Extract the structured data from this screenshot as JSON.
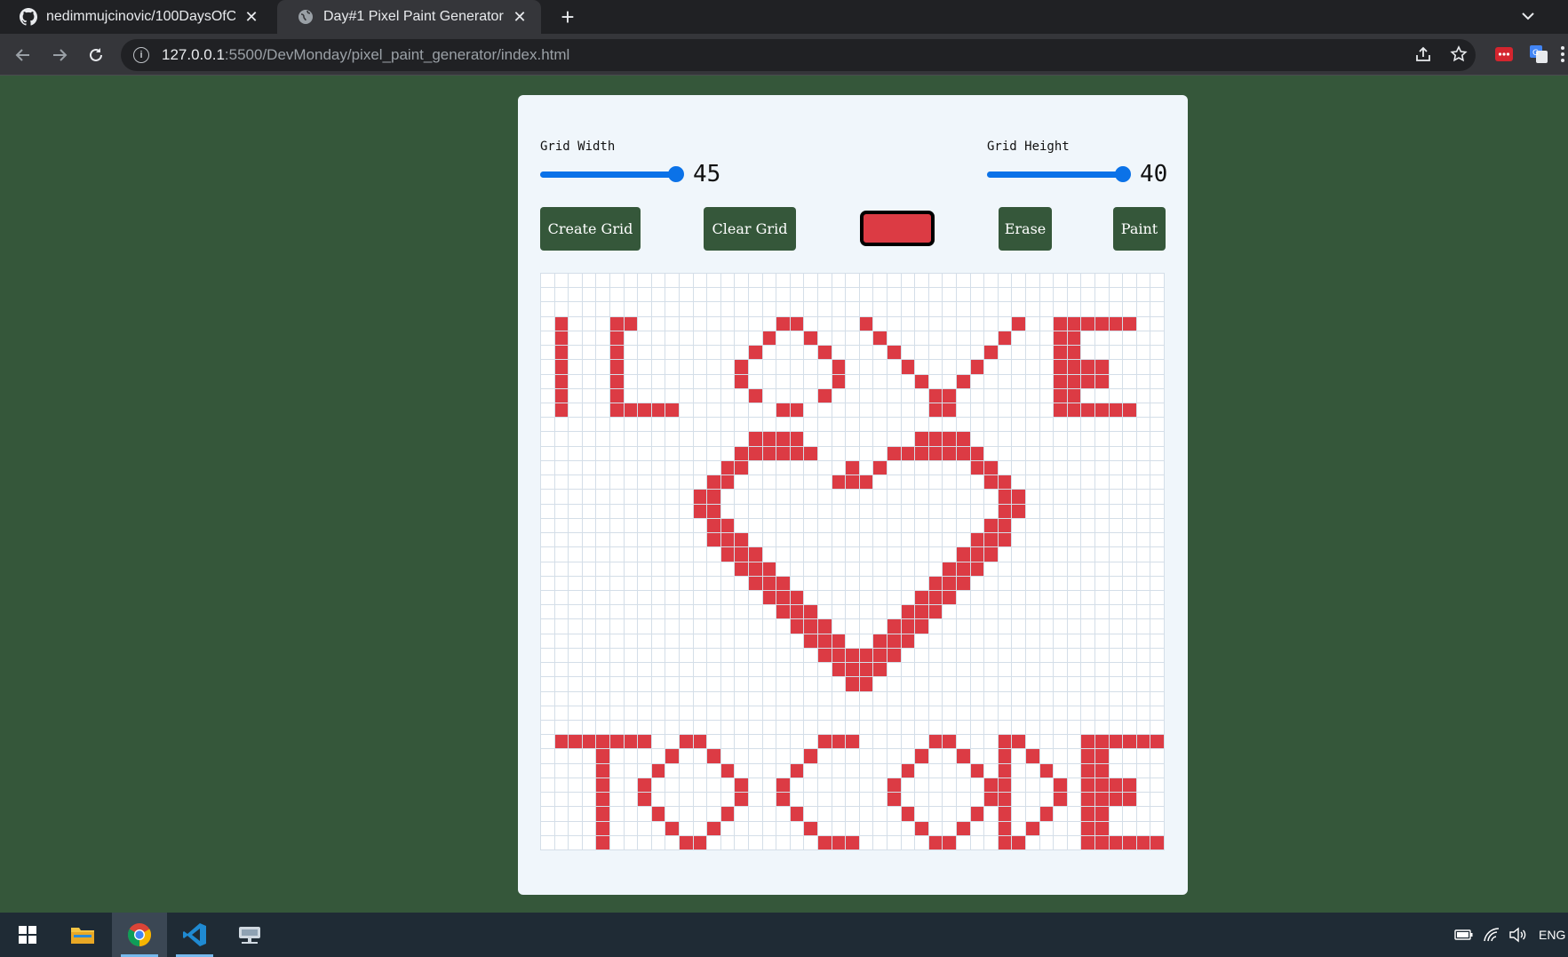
{
  "browser": {
    "tabs": [
      {
        "title": "nedimmujcinovic/100DaysOfCode",
        "icon": "github-icon",
        "active": false
      },
      {
        "title": "Day#1 Pixel Paint Generator",
        "icon": "globe-icon",
        "active": true
      }
    ],
    "new_tab": "+",
    "url_host": "127.0.0.1",
    "url_rest": ":5500/DevMonday/pixel_paint_generator/index.html"
  },
  "controls": {
    "width_label": "Grid Width",
    "width_value": "45",
    "width_range": [
      1,
      45
    ],
    "height_label": "Grid Height",
    "height_value": "40",
    "height_range": [
      1,
      40
    ],
    "create_label": "Create Grid",
    "clear_label": "Clear Grid",
    "erase_label": "Erase",
    "paint_label": "Paint",
    "paint_color": "#dc3b44"
  },
  "grid": {
    "cols": 45,
    "rows": 40,
    "cell_color": "#ffffff",
    "painted_color": "#dc3b44",
    "painted": [
      [
        3,
        1
      ],
      [
        3,
        5
      ],
      [
        3,
        6
      ],
      [
        3,
        17
      ],
      [
        3,
        18
      ],
      [
        3,
        23
      ],
      [
        3,
        34
      ],
      [
        3,
        37
      ],
      [
        3,
        38
      ],
      [
        3,
        39
      ],
      [
        3,
        40
      ],
      [
        3,
        41
      ],
      [
        3,
        42
      ],
      [
        4,
        1
      ],
      [
        4,
        5
      ],
      [
        4,
        16
      ],
      [
        4,
        19
      ],
      [
        4,
        24
      ],
      [
        4,
        33
      ],
      [
        4,
        37
      ],
      [
        4,
        38
      ],
      [
        5,
        1
      ],
      [
        5,
        5
      ],
      [
        5,
        15
      ],
      [
        5,
        20
      ],
      [
        5,
        25
      ],
      [
        5,
        32
      ],
      [
        5,
        37
      ],
      [
        5,
        38
      ],
      [
        6,
        1
      ],
      [
        6,
        5
      ],
      [
        6,
        14
      ],
      [
        6,
        21
      ],
      [
        6,
        26
      ],
      [
        6,
        31
      ],
      [
        6,
        37
      ],
      [
        6,
        38
      ],
      [
        6,
        39
      ],
      [
        6,
        40
      ],
      [
        7,
        1
      ],
      [
        7,
        5
      ],
      [
        7,
        14
      ],
      [
        7,
        21
      ],
      [
        7,
        27
      ],
      [
        7,
        30
      ],
      [
        7,
        37
      ],
      [
        7,
        38
      ],
      [
        7,
        39
      ],
      [
        7,
        40
      ],
      [
        8,
        1
      ],
      [
        8,
        5
      ],
      [
        8,
        15
      ],
      [
        8,
        20
      ],
      [
        8,
        28
      ],
      [
        8,
        29
      ],
      [
        8,
        37
      ],
      [
        8,
        38
      ],
      [
        9,
        1
      ],
      [
        9,
        5
      ],
      [
        9,
        6
      ],
      [
        9,
        7
      ],
      [
        9,
        8
      ],
      [
        9,
        9
      ],
      [
        9,
        17
      ],
      [
        9,
        18
      ],
      [
        9,
        28
      ],
      [
        9,
        29
      ],
      [
        9,
        37
      ],
      [
        9,
        38
      ],
      [
        9,
        39
      ],
      [
        9,
        40
      ],
      [
        9,
        41
      ],
      [
        9,
        42
      ],
      [
        11,
        15
      ],
      [
        11,
        16
      ],
      [
        11,
        17
      ],
      [
        11,
        18
      ],
      [
        11,
        27
      ],
      [
        11,
        28
      ],
      [
        11,
        29
      ],
      [
        11,
        30
      ],
      [
        12,
        14
      ],
      [
        12,
        15
      ],
      [
        12,
        16
      ],
      [
        12,
        17
      ],
      [
        12,
        18
      ],
      [
        12,
        19
      ],
      [
        12,
        25
      ],
      [
        12,
        26
      ],
      [
        12,
        27
      ],
      [
        12,
        28
      ],
      [
        12,
        29
      ],
      [
        12,
        30
      ],
      [
        12,
        31
      ],
      [
        13,
        13
      ],
      [
        13,
        14
      ],
      [
        13,
        22
      ],
      [
        13,
        24
      ],
      [
        13,
        31
      ],
      [
        13,
        32
      ],
      [
        14,
        12
      ],
      [
        14,
        13
      ],
      [
        14,
        21
      ],
      [
        14,
        22
      ],
      [
        14,
        23
      ],
      [
        14,
        32
      ],
      [
        14,
        33
      ],
      [
        15,
        11
      ],
      [
        15,
        12
      ],
      [
        15,
        33
      ],
      [
        15,
        34
      ],
      [
        16,
        11
      ],
      [
        16,
        12
      ],
      [
        16,
        33
      ],
      [
        16,
        34
      ],
      [
        17,
        12
      ],
      [
        17,
        13
      ],
      [
        17,
        32
      ],
      [
        17,
        33
      ],
      [
        18,
        12
      ],
      [
        18,
        13
      ],
      [
        18,
        14
      ],
      [
        18,
        31
      ],
      [
        18,
        32
      ],
      [
        18,
        33
      ],
      [
        19,
        13
      ],
      [
        19,
        14
      ],
      [
        19,
        15
      ],
      [
        19,
        30
      ],
      [
        19,
        31
      ],
      [
        19,
        32
      ],
      [
        20,
        14
      ],
      [
        20,
        15
      ],
      [
        20,
        16
      ],
      [
        20,
        29
      ],
      [
        20,
        30
      ],
      [
        20,
        31
      ],
      [
        21,
        15
      ],
      [
        21,
        16
      ],
      [
        21,
        17
      ],
      [
        21,
        28
      ],
      [
        21,
        29
      ],
      [
        21,
        30
      ],
      [
        22,
        16
      ],
      [
        22,
        17
      ],
      [
        22,
        18
      ],
      [
        22,
        27
      ],
      [
        22,
        28
      ],
      [
        22,
        29
      ],
      [
        23,
        17
      ],
      [
        23,
        18
      ],
      [
        23,
        19
      ],
      [
        23,
        26
      ],
      [
        23,
        27
      ],
      [
        23,
        28
      ],
      [
        24,
        18
      ],
      [
        24,
        19
      ],
      [
        24,
        20
      ],
      [
        24,
        25
      ],
      [
        24,
        26
      ],
      [
        24,
        27
      ],
      [
        25,
        19
      ],
      [
        25,
        20
      ],
      [
        25,
        21
      ],
      [
        25,
        24
      ],
      [
        25,
        25
      ],
      [
        25,
        26
      ],
      [
        26,
        20
      ],
      [
        26,
        21
      ],
      [
        26,
        22
      ],
      [
        26,
        23
      ],
      [
        26,
        24
      ],
      [
        26,
        25
      ],
      [
        27,
        21
      ],
      [
        27,
        22
      ],
      [
        27,
        23
      ],
      [
        27,
        24
      ],
      [
        28,
        22
      ],
      [
        28,
        23
      ],
      [
        32,
        1
      ],
      [
        32,
        2
      ],
      [
        32,
        3
      ],
      [
        32,
        4
      ],
      [
        32,
        5
      ],
      [
        32,
        6
      ],
      [
        32,
        7
      ],
      [
        32,
        10
      ],
      [
        32,
        11
      ],
      [
        32,
        20
      ],
      [
        32,
        21
      ],
      [
        32,
        22
      ],
      [
        32,
        28
      ],
      [
        32,
        29
      ],
      [
        32,
        33
      ],
      [
        32,
        34
      ],
      [
        32,
        39
      ],
      [
        32,
        40
      ],
      [
        32,
        41
      ],
      [
        32,
        42
      ],
      [
        32,
        43
      ],
      [
        32,
        44
      ],
      [
        33,
        4
      ],
      [
        33,
        9
      ],
      [
        33,
        12
      ],
      [
        33,
        19
      ],
      [
        33,
        27
      ],
      [
        33,
        30
      ],
      [
        33,
        33
      ],
      [
        33,
        35
      ],
      [
        33,
        39
      ],
      [
        33,
        40
      ],
      [
        34,
        4
      ],
      [
        34,
        8
      ],
      [
        34,
        13
      ],
      [
        34,
        18
      ],
      [
        34,
        26
      ],
      [
        34,
        31
      ],
      [
        34,
        33
      ],
      [
        34,
        36
      ],
      [
        34,
        39
      ],
      [
        34,
        40
      ],
      [
        35,
        4
      ],
      [
        35,
        7
      ],
      [
        35,
        14
      ],
      [
        35,
        17
      ],
      [
        35,
        25
      ],
      [
        35,
        32
      ],
      [
        35,
        33
      ],
      [
        35,
        37
      ],
      [
        35,
        39
      ],
      [
        35,
        40
      ],
      [
        35,
        41
      ],
      [
        35,
        42
      ],
      [
        36,
        4
      ],
      [
        36,
        7
      ],
      [
        36,
        14
      ],
      [
        36,
        17
      ],
      [
        36,
        25
      ],
      [
        36,
        32
      ],
      [
        36,
        33
      ],
      [
        36,
        37
      ],
      [
        36,
        39
      ],
      [
        36,
        40
      ],
      [
        36,
        41
      ],
      [
        36,
        42
      ],
      [
        37,
        4
      ],
      [
        37,
        8
      ],
      [
        37,
        13
      ],
      [
        37,
        18
      ],
      [
        37,
        26
      ],
      [
        37,
        31
      ],
      [
        37,
        33
      ],
      [
        37,
        36
      ],
      [
        37,
        39
      ],
      [
        37,
        40
      ],
      [
        38,
        4
      ],
      [
        38,
        9
      ],
      [
        38,
        12
      ],
      [
        38,
        19
      ],
      [
        38,
        27
      ],
      [
        38,
        30
      ],
      [
        38,
        33
      ],
      [
        38,
        35
      ],
      [
        38,
        39
      ],
      [
        38,
        40
      ],
      [
        39,
        4
      ],
      [
        39,
        10
      ],
      [
        39,
        11
      ],
      [
        39,
        20
      ],
      [
        39,
        21
      ],
      [
        39,
        22
      ],
      [
        39,
        28
      ],
      [
        39,
        29
      ],
      [
        39,
        33
      ],
      [
        39,
        34
      ],
      [
        39,
        39
      ],
      [
        39,
        40
      ],
      [
        39,
        41
      ],
      [
        39,
        42
      ],
      [
        39,
        43
      ],
      [
        39,
        44
      ]
    ]
  },
  "taskbar": {
    "apps": [
      "windows-start-icon",
      "file-explorer-icon",
      "chrome-icon",
      "vscode-icon",
      "network-drive-icon"
    ],
    "tray_language": "ENG"
  }
}
